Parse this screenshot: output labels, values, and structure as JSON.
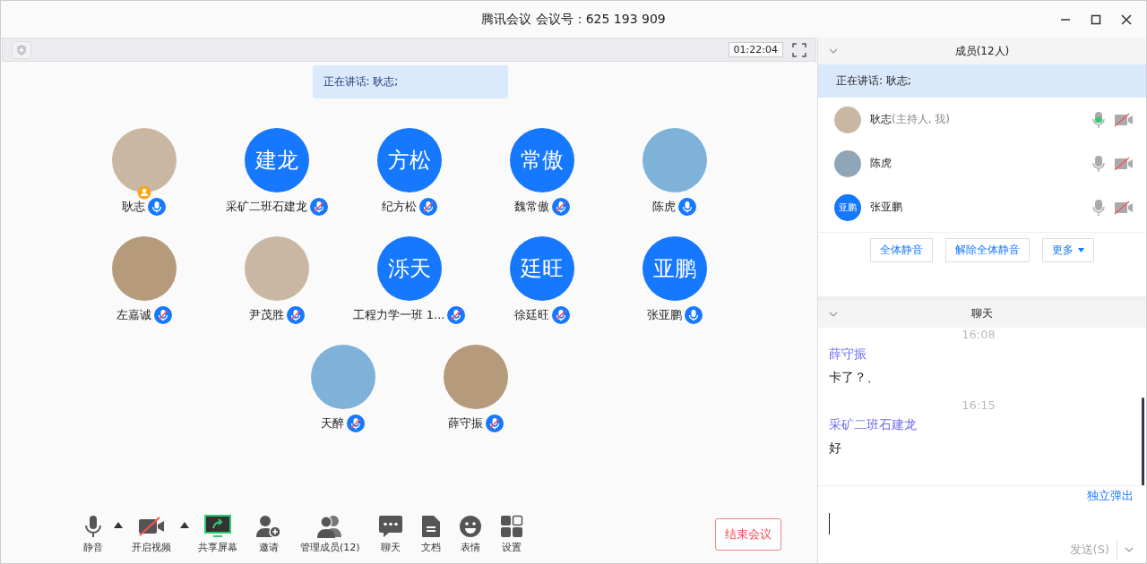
{
  "window": {
    "title": "腾讯会议 会议号：625 193 909"
  },
  "meeting_bar": {
    "timer": "01:22:04"
  },
  "speaking_banner": "正在讲话: 耿志;",
  "participants": [
    {
      "name": "耿志",
      "muted": false,
      "host": true
    },
    {
      "name": "采矿二班石建龙",
      "initials": "建龙",
      "muted": true,
      "host": false
    },
    {
      "name": "纪方松",
      "initials": "方松",
      "muted": true,
      "host": false
    },
    {
      "name": "魏常傲",
      "initials": "常傲",
      "muted": true,
      "host": false
    },
    {
      "name": "陈虎",
      "muted": false,
      "host": false
    },
    {
      "name": "左嘉诚",
      "muted": true,
      "host": false
    },
    {
      "name": "尹茂胜",
      "muted": true,
      "host": false
    },
    {
      "name": "工程力学一班 1...",
      "initials": "泺天",
      "muted": true,
      "host": false
    },
    {
      "name": "徐廷旺",
      "initials": "廷旺",
      "muted": true,
      "host": false
    },
    {
      "name": "张亚鹏",
      "initials": "亚鹏",
      "muted": false,
      "host": false
    },
    {
      "name": "天醉",
      "muted": true,
      "host": false
    },
    {
      "name": "薛守振",
      "muted": true,
      "host": false
    }
  ],
  "toolbar": [
    {
      "label": "静音",
      "menu": true
    },
    {
      "label": "开启视频",
      "menu": true
    },
    {
      "label": "共享屏幕",
      "menu": false
    },
    {
      "label": "邀请",
      "menu": false
    },
    {
      "label": "管理成员(12)",
      "menu": false
    },
    {
      "label": "聊天",
      "menu": false
    },
    {
      "label": "文档",
      "menu": false
    },
    {
      "label": "表情",
      "menu": false
    },
    {
      "label": "设置",
      "menu": false
    }
  ],
  "end_button": "结束会议",
  "members_panel": {
    "title": "成员(12人)",
    "speaking": "正在讲话: 耿志;",
    "members": [
      {
        "name": "耿志",
        "role": "(主持人, 我)",
        "speaking": true
      },
      {
        "name": "陈虎",
        "speaking": false
      },
      {
        "name": "张亚鹏",
        "initials": "亚鹏",
        "speaking": false
      }
    ],
    "buttons": [
      "全体静音",
      "解除全体静音",
      "更多"
    ]
  },
  "chat_panel": {
    "title": "聊天",
    "messages": [
      {
        "kind": "time",
        "text": "16:08"
      },
      {
        "kind": "sender",
        "text": "薛守振"
      },
      {
        "kind": "text",
        "text": "卡了？、"
      },
      {
        "kind": "time",
        "text": "16:15"
      },
      {
        "kind": "sender",
        "text": "采矿二班石建龙"
      },
      {
        "kind": "text",
        "text": "好"
      }
    ],
    "popout": "独立弹出",
    "send": "发送(S)"
  }
}
